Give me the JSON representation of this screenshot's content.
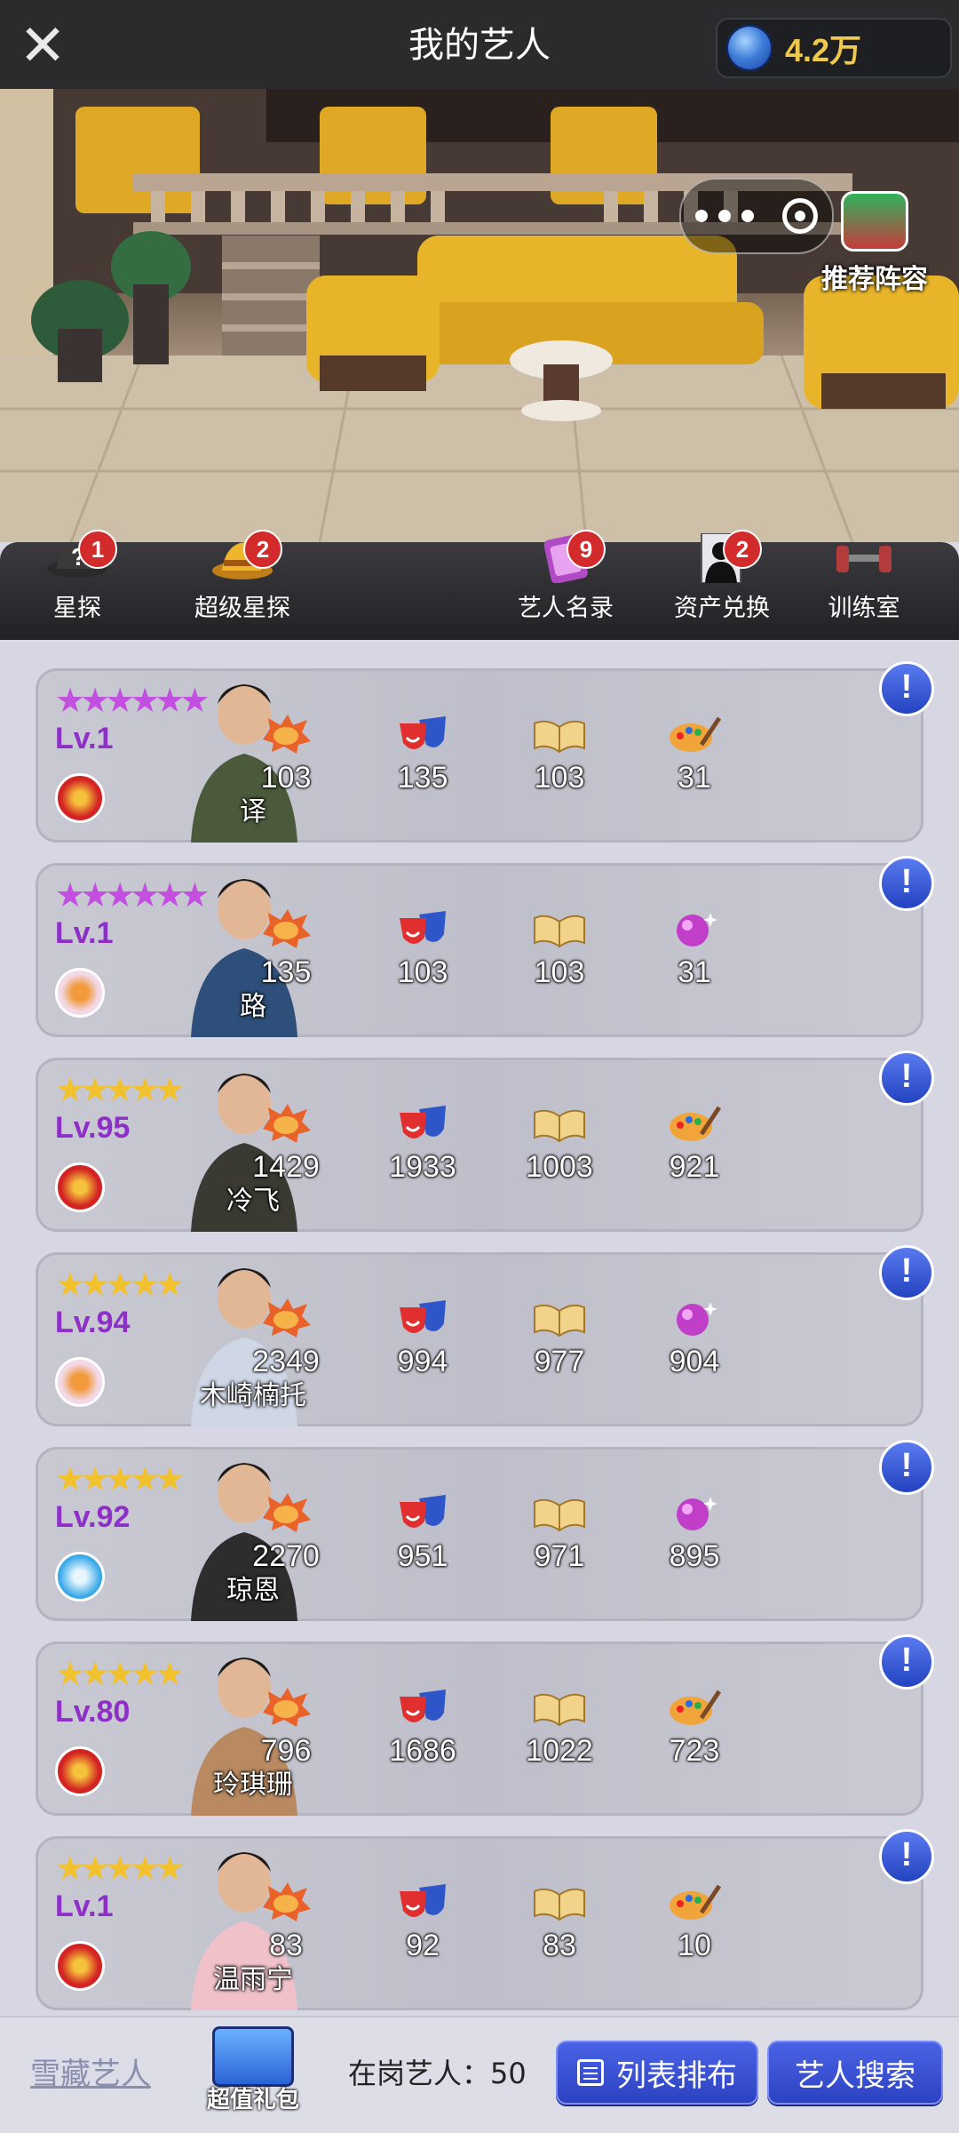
{
  "header": {
    "close_icon": "close-icon",
    "title": "我的艺人",
    "currency": {
      "icon": "globe-icon",
      "value": "4.2万"
    }
  },
  "hero": {
    "more_icon": "more-dots-icon",
    "record_icon": "target-icon",
    "recommend_label": "推荐阵容"
  },
  "features": [
    {
      "label": "星探",
      "icon": "scout-hat-icon",
      "badge": "1"
    },
    {
      "label": "超级星探",
      "icon": "super-scout-hat-icon",
      "badge": "2"
    },
    {
      "label": "艺人名录",
      "icon": "directory-book-icon",
      "badge": "9"
    },
    {
      "label": "资产兑换",
      "icon": "silhouette-card-icon",
      "badge": "2"
    },
    {
      "label": "训练室",
      "icon": "dumbbell-icon",
      "badge": ""
    }
  ],
  "artists": [
    {
      "name": "译",
      "level": "Lv.1",
      "stars": 6,
      "star_color": "#c24fe0",
      "badge": "red",
      "stats": [
        "103",
        "135",
        "103",
        "31"
      ],
      "last_icon": "palette-icon"
    },
    {
      "name": "路",
      "level": "Lv.1",
      "stars": 6,
      "star_color": "#c24fe0",
      "badge": "flower",
      "stats": [
        "135",
        "103",
        "103",
        "31"
      ],
      "last_icon": "disco-ball-icon"
    },
    {
      "name": "冷飞",
      "level": "Lv.95",
      "stars": 5,
      "star_color": "#f2c12e",
      "badge": "red",
      "stats": [
        "1429",
        "1933",
        "1003",
        "921"
      ],
      "last_icon": "palette-icon"
    },
    {
      "name": "木崎楠托",
      "level": "Lv.94",
      "stars": 5,
      "star_color": "#f2c12e",
      "badge": "flower",
      "stats": [
        "2349",
        "994",
        "977",
        "904"
      ],
      "last_icon": "disco-ball-icon"
    },
    {
      "name": "琼恩",
      "level": "Lv.92",
      "stars": 5,
      "star_color": "#f2c12e",
      "badge": "blue",
      "stats": [
        "2270",
        "951",
        "971",
        "895"
      ],
      "last_icon": "disco-ball-icon"
    },
    {
      "name": "玲琪珊",
      "level": "Lv.80",
      "stars": 5,
      "star_color": "#f2c12e",
      "badge": "red",
      "stats": [
        "796",
        "1686",
        "1022",
        "723"
      ],
      "last_icon": "palette-icon"
    },
    {
      "name": "温雨宁",
      "level": "Lv.1",
      "stars": 5,
      "star_color": "#f2c12e",
      "badge": "red",
      "stats": [
        "83",
        "92",
        "83",
        "10"
      ],
      "last_icon": "palette-icon"
    }
  ],
  "stat_icons": [
    "explosion-icon",
    "drama-masks-icon",
    "open-book-icon"
  ],
  "footer": {
    "collection_label": "雪藏艺人",
    "gift_label": "超值礼包",
    "on_duty_label": "在岗艺人：50",
    "list_button": "列表排布",
    "search_button": "艺人搜索"
  }
}
